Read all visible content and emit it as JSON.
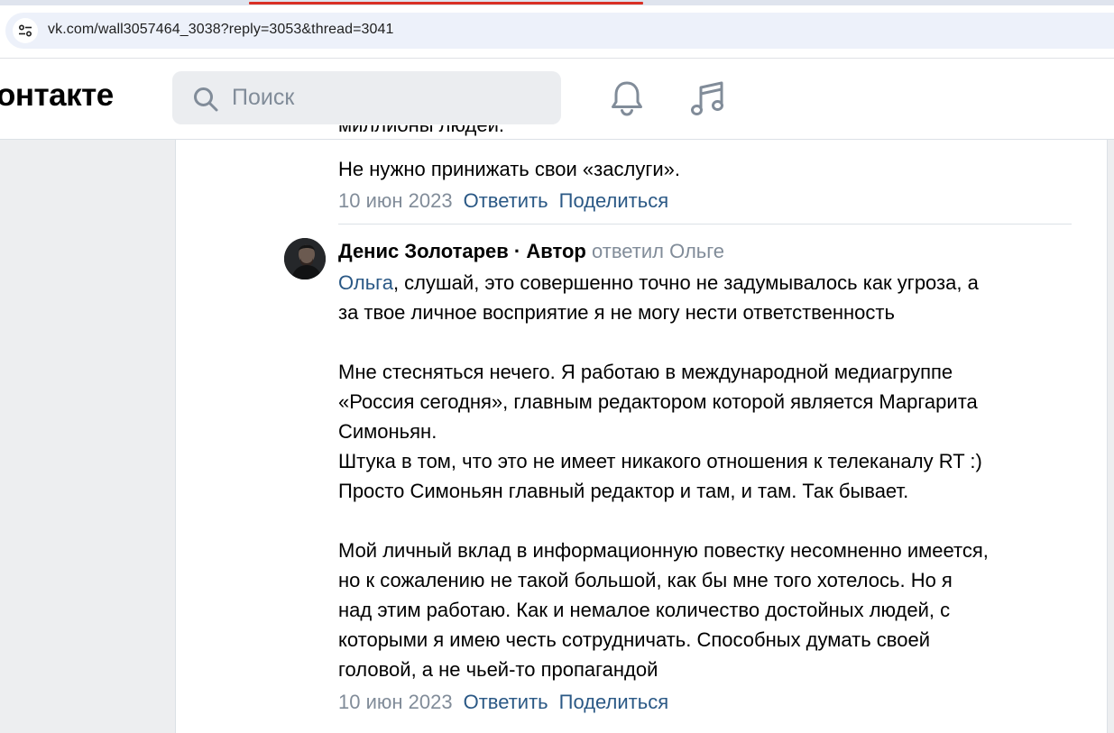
{
  "browser": {
    "url": "vk.com/wall3057464_3038?reply=3053&thread=3041"
  },
  "header": {
    "logo_text": "онтакте",
    "search_placeholder": "Поиск",
    "icons": [
      "bell-icon",
      "music-icon"
    ]
  },
  "prev_comment": {
    "cut_line": "миллионы людей.",
    "last_line": "Не нужно принижать свои «заслуги».",
    "date": "10 июн 2023",
    "reply_label": "Ответить",
    "share_label": "Поделиться"
  },
  "comment": {
    "author": "Денис Золотарев",
    "separator": "·",
    "role": "Автор",
    "replied_to": "ответил Ольге",
    "mention": "Ольга",
    "paragraphs": [
      [
        ", слушай, это совершенно точно не задумывалось как угроза, а",
        "за твое личное восприятие я не могу нести ответственность"
      ],
      [
        "Мне стесняться нечего. Я работаю в международной медиагруппе",
        "«Россия сегодня», главным редактором которой является Маргарита",
        "Симоньян.",
        "Штука в том, что это не имеет никакого отношения к телеканалу RT :)",
        "Просто Симоньян главный редактор и там, и там. Так бывает."
      ],
      [
        "Мой личный вклад в информационную повестку несомненно имеется,",
        "но к сожалению не такой большой, как бы мне того хотелось. Но я",
        "над этим работаю. Как и немалое количество достойных людей, с",
        "которыми я имею честь сотрудничать. Способных думать своей",
        "головой, а не чьей-то пропагандой"
      ]
    ],
    "date": "10 июн 2023",
    "reply_label": "Ответить",
    "share_label": "Поделиться"
  },
  "colors": {
    "link": "#2a5885",
    "muted": "#818c99",
    "page_bg": "#edeef0"
  }
}
